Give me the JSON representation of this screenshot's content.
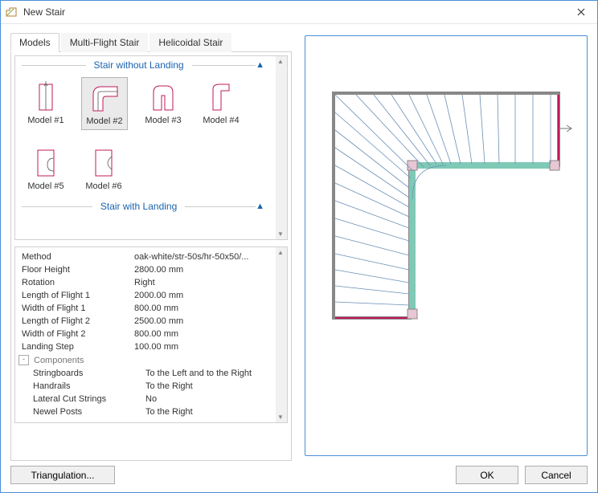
{
  "window": {
    "title": "New Stair"
  },
  "tabs": [
    "Models",
    "Multi-Flight Stair",
    "Helicoidal Stair"
  ],
  "activeTab": 0,
  "sections": {
    "noLanding": {
      "label": "Stair without Landing"
    },
    "withLanding": {
      "label": "Stair with Landing"
    }
  },
  "models": [
    {
      "id": "m1",
      "label": "Model #1"
    },
    {
      "id": "m2",
      "label": "Model #2",
      "selected": true
    },
    {
      "id": "m3",
      "label": "Model #3"
    },
    {
      "id": "m4",
      "label": "Model #4"
    },
    {
      "id": "m5",
      "label": "Model #5"
    },
    {
      "id": "m6",
      "label": "Model #6"
    }
  ],
  "props": {
    "rows": [
      {
        "k": "Method",
        "v": "oak-white/str-50s/hr-50x50/..."
      },
      {
        "k": "Floor Height",
        "v": "2800.00 mm"
      },
      {
        "k": "Rotation",
        "v": "Right"
      },
      {
        "k": "Length of Flight 1",
        "v": "2000.00 mm"
      },
      {
        "k": "Width of Flight 1",
        "v": "800.00 mm"
      },
      {
        "k": "Length of Flight 2",
        "v": "2500.00 mm"
      },
      {
        "k": "Width of Flight 2",
        "v": "800.00 mm"
      },
      {
        "k": "Landing Step",
        "v": "100.00 mm"
      }
    ],
    "group": {
      "label": "Components",
      "open": true
    },
    "subrows": [
      {
        "k": "Stringboards",
        "v": "To the Left and to the Right"
      },
      {
        "k": "Handrails",
        "v": "To the Right"
      },
      {
        "k": "Lateral Cut Strings",
        "v": "No"
      },
      {
        "k": "Newel Posts",
        "v": "To the Right"
      }
    ]
  },
  "buttons": {
    "triangulation": "Triangulation...",
    "ok": "OK",
    "cancel": "Cancel"
  }
}
